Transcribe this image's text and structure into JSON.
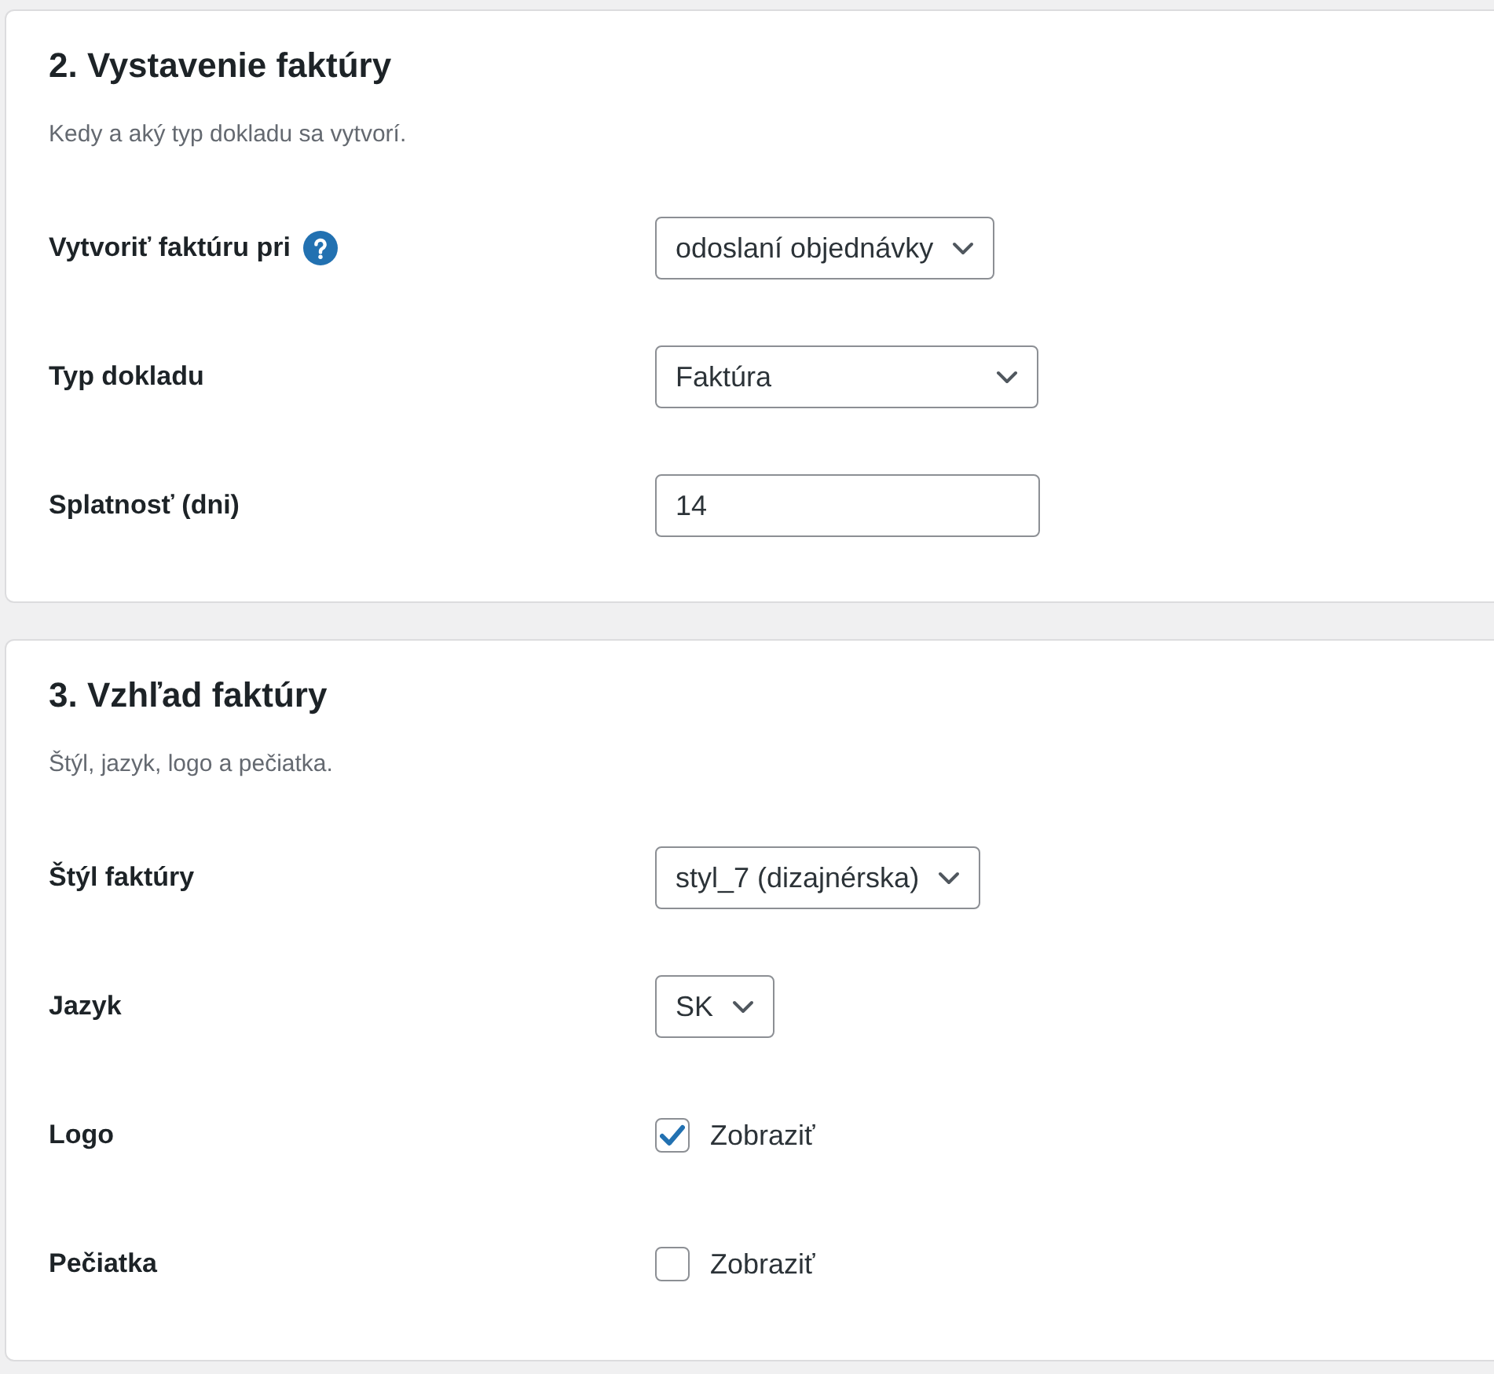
{
  "sections": [
    {
      "title": "2. Vystavenie faktúry",
      "description": "Kedy a aký typ dokladu sa vytvorí.",
      "fields": [
        {
          "kind": "select",
          "label": "Vytvoriť faktúru pri",
          "help": true,
          "value": "odoslaní objednávky"
        },
        {
          "kind": "select",
          "label": "Typ dokladu",
          "help": false,
          "value": "Faktúra"
        },
        {
          "kind": "text",
          "label": "Splatnosť (dni)",
          "help": false,
          "value": "14"
        }
      ]
    },
    {
      "title": "3. Vzhľad faktúry",
      "description": "Štýl, jazyk, logo a pečiatka.",
      "fields": [
        {
          "kind": "select",
          "label": "Štýl faktúry",
          "help": false,
          "value": "styl_7 (dizajnérska)"
        },
        {
          "kind": "select",
          "label": "Jazyk",
          "help": false,
          "value": "SK"
        },
        {
          "kind": "checkbox",
          "label": "Logo",
          "help": false,
          "checked": true,
          "option": "Zobraziť"
        },
        {
          "kind": "checkbox",
          "label": "Pečiatka",
          "help": false,
          "checked": false,
          "option": "Zobraziť"
        }
      ]
    }
  ]
}
